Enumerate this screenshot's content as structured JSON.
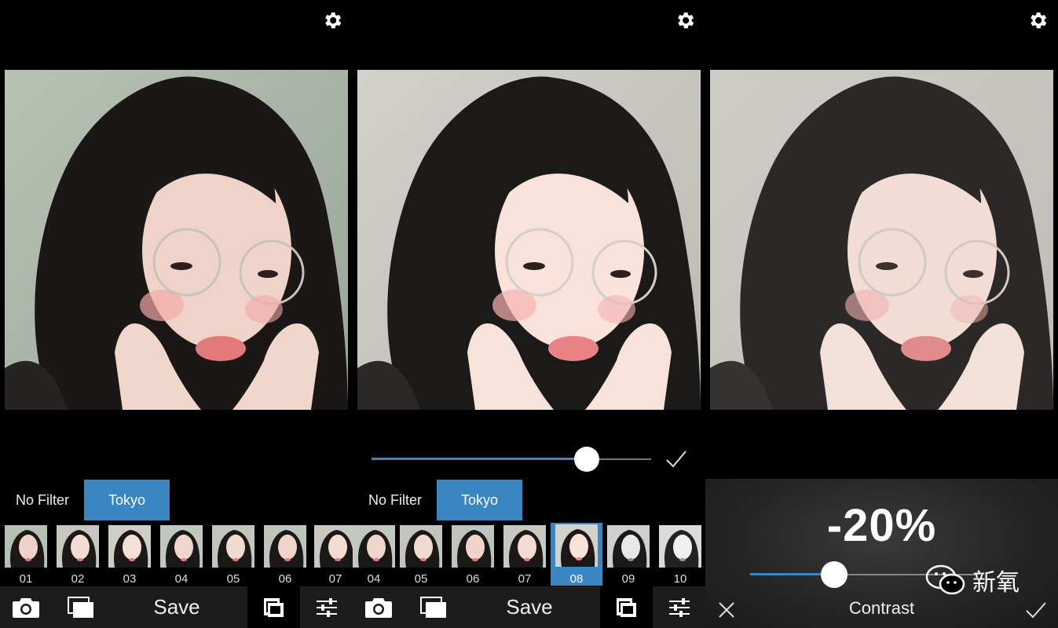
{
  "panels": [
    {
      "filters": {
        "no_filter": "No Filter",
        "active": "Tokyo"
      },
      "thumbs": [
        "01",
        "02",
        "03",
        "04",
        "05",
        "06",
        "07"
      ],
      "toolbar": {
        "save": "Save"
      }
    },
    {
      "slider": {
        "value_fraction": 0.77
      },
      "filters": {
        "no_filter": "No Filter",
        "active": "Tokyo"
      },
      "thumbs": [
        "04",
        "05",
        "06",
        "07",
        "08",
        "09",
        "10"
      ],
      "selected_thumb": "08",
      "toolbar": {
        "save": "Save"
      }
    },
    {
      "adjust": {
        "value": "-20%",
        "name": "Contrast",
        "value_fraction": 0.37
      }
    }
  ],
  "watermark": {
    "text": "新氧"
  },
  "colors": {
    "accent": "#3a86c2",
    "toolbar": "#1c1c1c",
    "background": "#000000"
  },
  "icons": [
    "gear-icon",
    "camera-icon",
    "gallery-icon",
    "film-icon",
    "sliders-icon",
    "check-icon",
    "close-icon",
    "wechat-icon"
  ]
}
